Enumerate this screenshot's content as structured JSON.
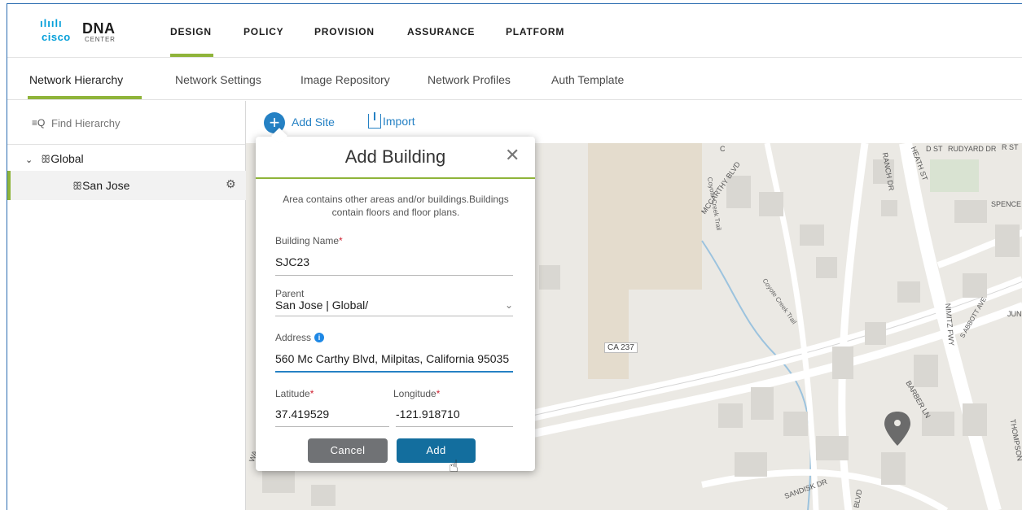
{
  "app": {
    "logo_brand": "cisco",
    "logo_product": "DNA",
    "logo_sub": "CENTER"
  },
  "topnav": {
    "items": [
      {
        "label": "DESIGN"
      },
      {
        "label": "POLICY"
      },
      {
        "label": "PROVISION"
      },
      {
        "label": "ASSURANCE"
      },
      {
        "label": "PLATFORM"
      }
    ],
    "active_index": 0
  },
  "subnav": {
    "items": [
      {
        "label": "Network Hierarchy"
      },
      {
        "label": "Network Settings"
      },
      {
        "label": "Image Repository"
      },
      {
        "label": "Network Profiles"
      },
      {
        "label": "Auth Template"
      }
    ],
    "active_index": 0
  },
  "sidebar": {
    "search_placeholder": "Find Hierarchy",
    "tree": {
      "root_label": "Global",
      "child_label": "San Jose"
    }
  },
  "toolbar": {
    "add_site_label": "Add Site",
    "import_label": "Import"
  },
  "map": {
    "labels": {
      "ca237": "CA 237",
      "mccarthy": "MCCARTHY BLVD",
      "ranch": "RANCH DR",
      "heath": "HEATH ST",
      "dst": "D ST",
      "rudyard": "RUDYARD DR",
      "rst": "R ST",
      "spence": "SPENCE",
      "coyote1": "Coyote Creek Trail",
      "coyote2": "Coyote Creek Trail",
      "nimitz": "NIMITZ FWY",
      "sabbott": "S ABBOTT AVE",
      "jun": "JUN",
      "barber": "BARBER LN",
      "thompson": "THOMPSON",
      "sandisk": "SANDISK DR",
      "wa": "WA",
      "c": "C",
      "blvd": "BLVD"
    }
  },
  "modal": {
    "title": "Add Building",
    "description": "Area contains other areas and/or buildings.Buildings contain floors and floor plans.",
    "building_name_label": "Building Name",
    "building_name_value": "SJC23",
    "parent_label": "Parent",
    "parent_value": "San Jose | Global/",
    "address_label": "Address",
    "address_value": "560 Mc Carthy Blvd, Milpitas, California 95035",
    "latitude_label": "Latitude",
    "latitude_value": "37.419529",
    "longitude_label": "Longitude",
    "longitude_value": "-121.918710",
    "cancel_label": "Cancel",
    "add_label": "Add"
  },
  "colors": {
    "accent_green": "#8fb43a",
    "link_blue": "#2581c4",
    "primary_button": "#136e9e",
    "secondary_button": "#707275",
    "required": "#cf2030"
  }
}
